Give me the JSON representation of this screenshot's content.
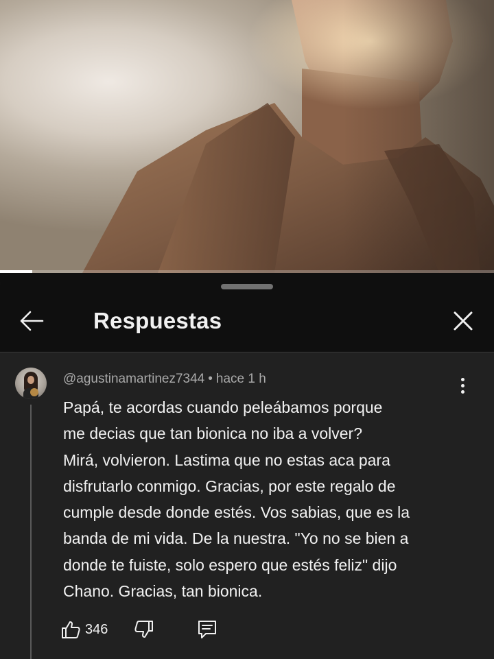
{
  "video": {
    "progress_percent": 6.5
  },
  "sheet": {
    "title": "Respuestas",
    "icons": {
      "back": "arrow-back-icon",
      "close": "close-icon"
    }
  },
  "comment": {
    "author": "@agustinamartinez7344",
    "separator": "•",
    "time": "hace 1 h",
    "lines": [
      "Papá, te acordas cuando peleábamos porque",
      "me decias que tan bionica no iba a volver?",
      "Mirá, volvieron. Lastima que no estas aca para",
      "disfrutarlo conmigo. Gracias, por este regalo de",
      "cumple desde donde estés. Vos sabias, que es la",
      "banda de mi vida. De la nuestra. \"Yo no se bien a",
      "donde te fuiste, solo espero que estés feliz\" dijo",
      "Chano. Gracias, tan bionica."
    ],
    "likes": "346",
    "icons": {
      "like": "thumbs-up-icon",
      "dislike": "thumbs-down-icon",
      "reply": "comment-icon",
      "menu": "more-vert-icon"
    }
  }
}
